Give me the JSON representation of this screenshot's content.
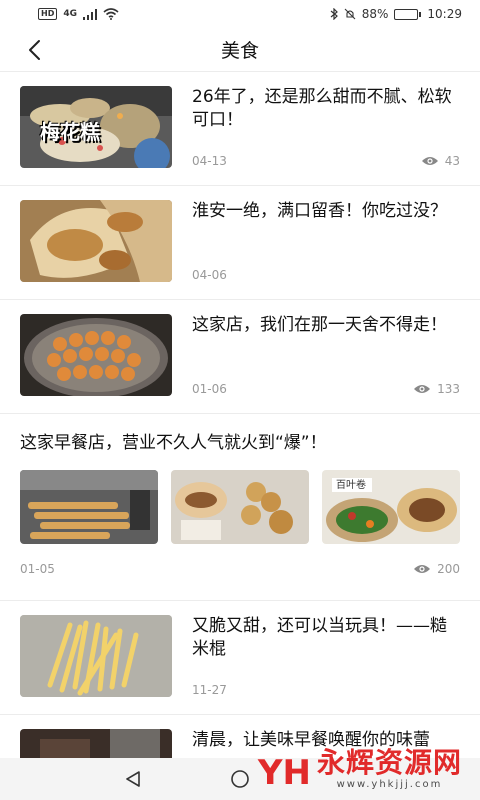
{
  "status_bar": {
    "network": "4G",
    "battery_percent": "88%",
    "battery_level": 0.88,
    "time": "10:29",
    "icons": [
      "hd-icon",
      "signal-icon",
      "wifi-icon",
      "bluetooth-icon",
      "mute-icon",
      "battery-icon"
    ]
  },
  "header": {
    "title": "美食",
    "back_icon": "chevron-left-icon"
  },
  "articles": [
    {
      "title": "26年了，还是那么甜而不腻、松软可口！",
      "date": "04-13",
      "views": "43",
      "thumb_caption": "梅花糕"
    },
    {
      "title": "淮安一绝，满口留香！你吃过没？",
      "date": "04-06",
      "views": ""
    },
    {
      "title": "这家店，我们在那一天舍不得走！",
      "date": "01-06",
      "views": "133"
    },
    {
      "title": "这家早餐店，营业不久人气就火到“爆”！",
      "date": "01-05",
      "views": "200",
      "image_count": 3,
      "thumb_caption": "百叶卷"
    },
    {
      "title": "又脆又甜，还可以当玩具！——糙米棍",
      "date": "11-27",
      "views": ""
    },
    {
      "title": "清晨，让美味早餐唤醒你的味蕾",
      "date": "",
      "views": ""
    }
  ],
  "nav_bar": {
    "icons": [
      "back-triangle-icon",
      "home-circle-icon"
    ]
  },
  "watermark": {
    "logo": "YH",
    "text": "永辉资源网",
    "url": "www.yhkjjj.com"
  },
  "colors": {
    "accent_watermark": "#e02020",
    "meta_gray": "#999999",
    "divider": "#ececec"
  }
}
